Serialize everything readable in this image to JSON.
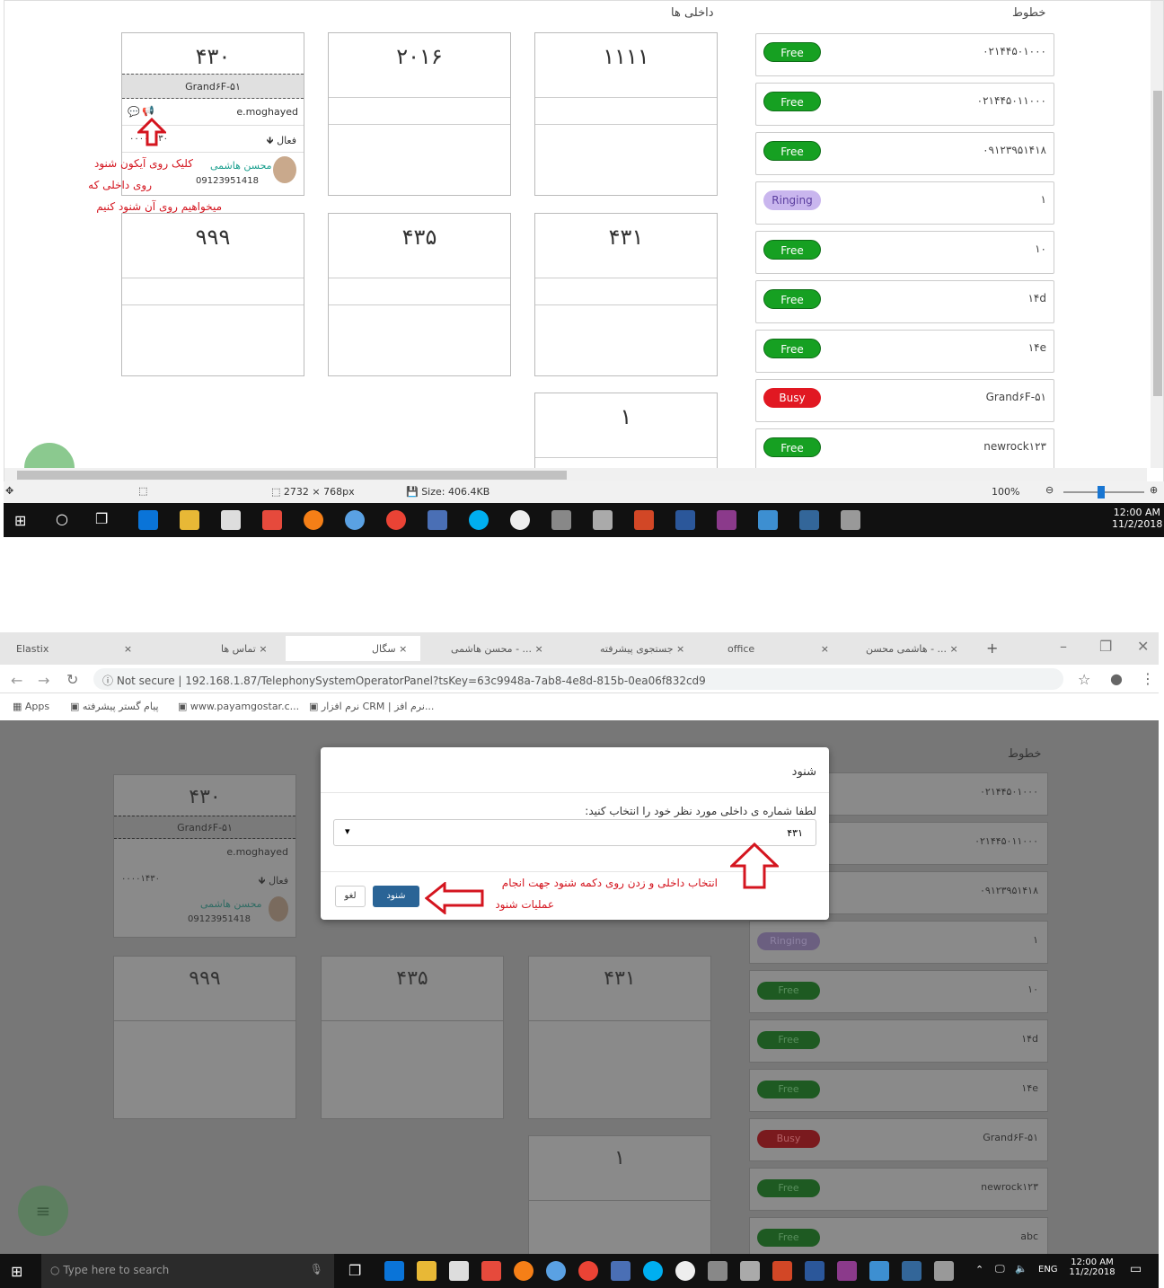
{
  "top": {
    "extensions_title": "داخلی ها",
    "lines_title": "خطوط",
    "tiles": [
      {
        "number": "۴۳۰",
        "line": "Grand۶F-۵۱",
        "user": "e.moghayed",
        "status": "فعال",
        "status_num": "۰۰۰۰۱۴۳۰",
        "person_name": "محسن هاشمی",
        "person_phone": "09123951418"
      },
      {
        "number": "۲۰۱۶"
      },
      {
        "number": "۱۱۱۱"
      },
      {
        "number": "۹۹۹"
      },
      {
        "number": "۴۳۵"
      },
      {
        "number": "۴۳۱"
      },
      {
        "number": "۱"
      }
    ],
    "annotation": [
      "کلیک روی آیکون شنود",
      "روی داخلی که",
      "میخواهیم روی آن شنود کنیم"
    ],
    "lines": [
      {
        "status": "Free",
        "number": "۰۲۱۴۴۵۰۱۰۰۰"
      },
      {
        "status": "Free",
        "number": "۰۲۱۴۴۵۰۱۱۰۰۰"
      },
      {
        "status": "Free",
        "number": "۰۹۱۲۳۹۵۱۴۱۸"
      },
      {
        "status": "Ringing",
        "number": "۱"
      },
      {
        "status": "Free",
        "number": "۱۰"
      },
      {
        "status": "Free",
        "number": "۱۴d"
      },
      {
        "status": "Free",
        "number": "۱۴e"
      },
      {
        "status": "Busy",
        "number": "Grand۶F-۵۱"
      },
      {
        "status": "Free",
        "number": "newrock۱۲۳"
      }
    ],
    "statusbar": {
      "dimensions": "2732 × 768px",
      "size": "Size: 406.4KB",
      "zoom": "100%"
    },
    "clock": {
      "time": "12:00 AM",
      "date": "11/2/2018"
    }
  },
  "bottom": {
    "tabs": [
      "Elastix",
      "تماس ها",
      "سگال",
      "محسن هاشمی - ...",
      "جستجوی پیشرفته",
      "office",
      "هاشمی محسن - ..."
    ],
    "url_security": "Not secure",
    "url": "192.168.1.87/TelephonySystemOperatorPanel?tsKey=63c9948a-7ab8-4e8d-815b-0ea06f832cd9",
    "bookmarks": [
      "Apps",
      "پیام گستر پیشرفته",
      "www.payamgostar.c...",
      "نرم افزار CRM | نرم افز..."
    ],
    "tiles": [
      {
        "number": "۴۳۰",
        "line": "Grand۶F-۵۱",
        "user": "e.moghayed",
        "status": "فعال",
        "status_num": "۰۰۰۰۱۴۳۰",
        "person_name": "محسن هاشمی",
        "person_phone": "09123951418"
      },
      {
        "number": "۹۹۹"
      },
      {
        "number": "۴۳۵"
      },
      {
        "number": "۴۳۱"
      },
      {
        "number": "۱"
      }
    ],
    "lines_title": "خطوط",
    "lines": [
      {
        "status": "",
        "number": "۰۲۱۴۴۵۰۱۰۰۰"
      },
      {
        "status": "",
        "number": "۰۲۱۴۴۵۰۱۱۰۰۰"
      },
      {
        "status": "",
        "number": "۰۹۱۲۳۹۵۱۴۱۸"
      },
      {
        "status": "Ringing",
        "number": "۱"
      },
      {
        "status": "Free",
        "number": "۱۰"
      },
      {
        "status": "Free",
        "number": "۱۴d"
      },
      {
        "status": "Free",
        "number": "۱۴e"
      },
      {
        "status": "Busy",
        "number": "Grand۶F-۵۱"
      },
      {
        "status": "Free",
        "number": "newrock۱۲۳"
      },
      {
        "status": "Free",
        "number": "abc"
      }
    ],
    "modal": {
      "title": "شنود",
      "prompt": "لطفا شماره ی داخلی مورد نظر خود را انتخاب کنید:",
      "selected": "۴۳۱",
      "confirm": "شنود",
      "cancel": "لغو",
      "annotation": [
        "انتخاب داخلی و زدن روی دکمه شنود جهت انجام",
        "عملیات شنود"
      ]
    },
    "search_placeholder": "Type here to search",
    "lang": "ENG",
    "clock": {
      "time": "12:00 AM",
      "date": "11/2/2018"
    }
  }
}
